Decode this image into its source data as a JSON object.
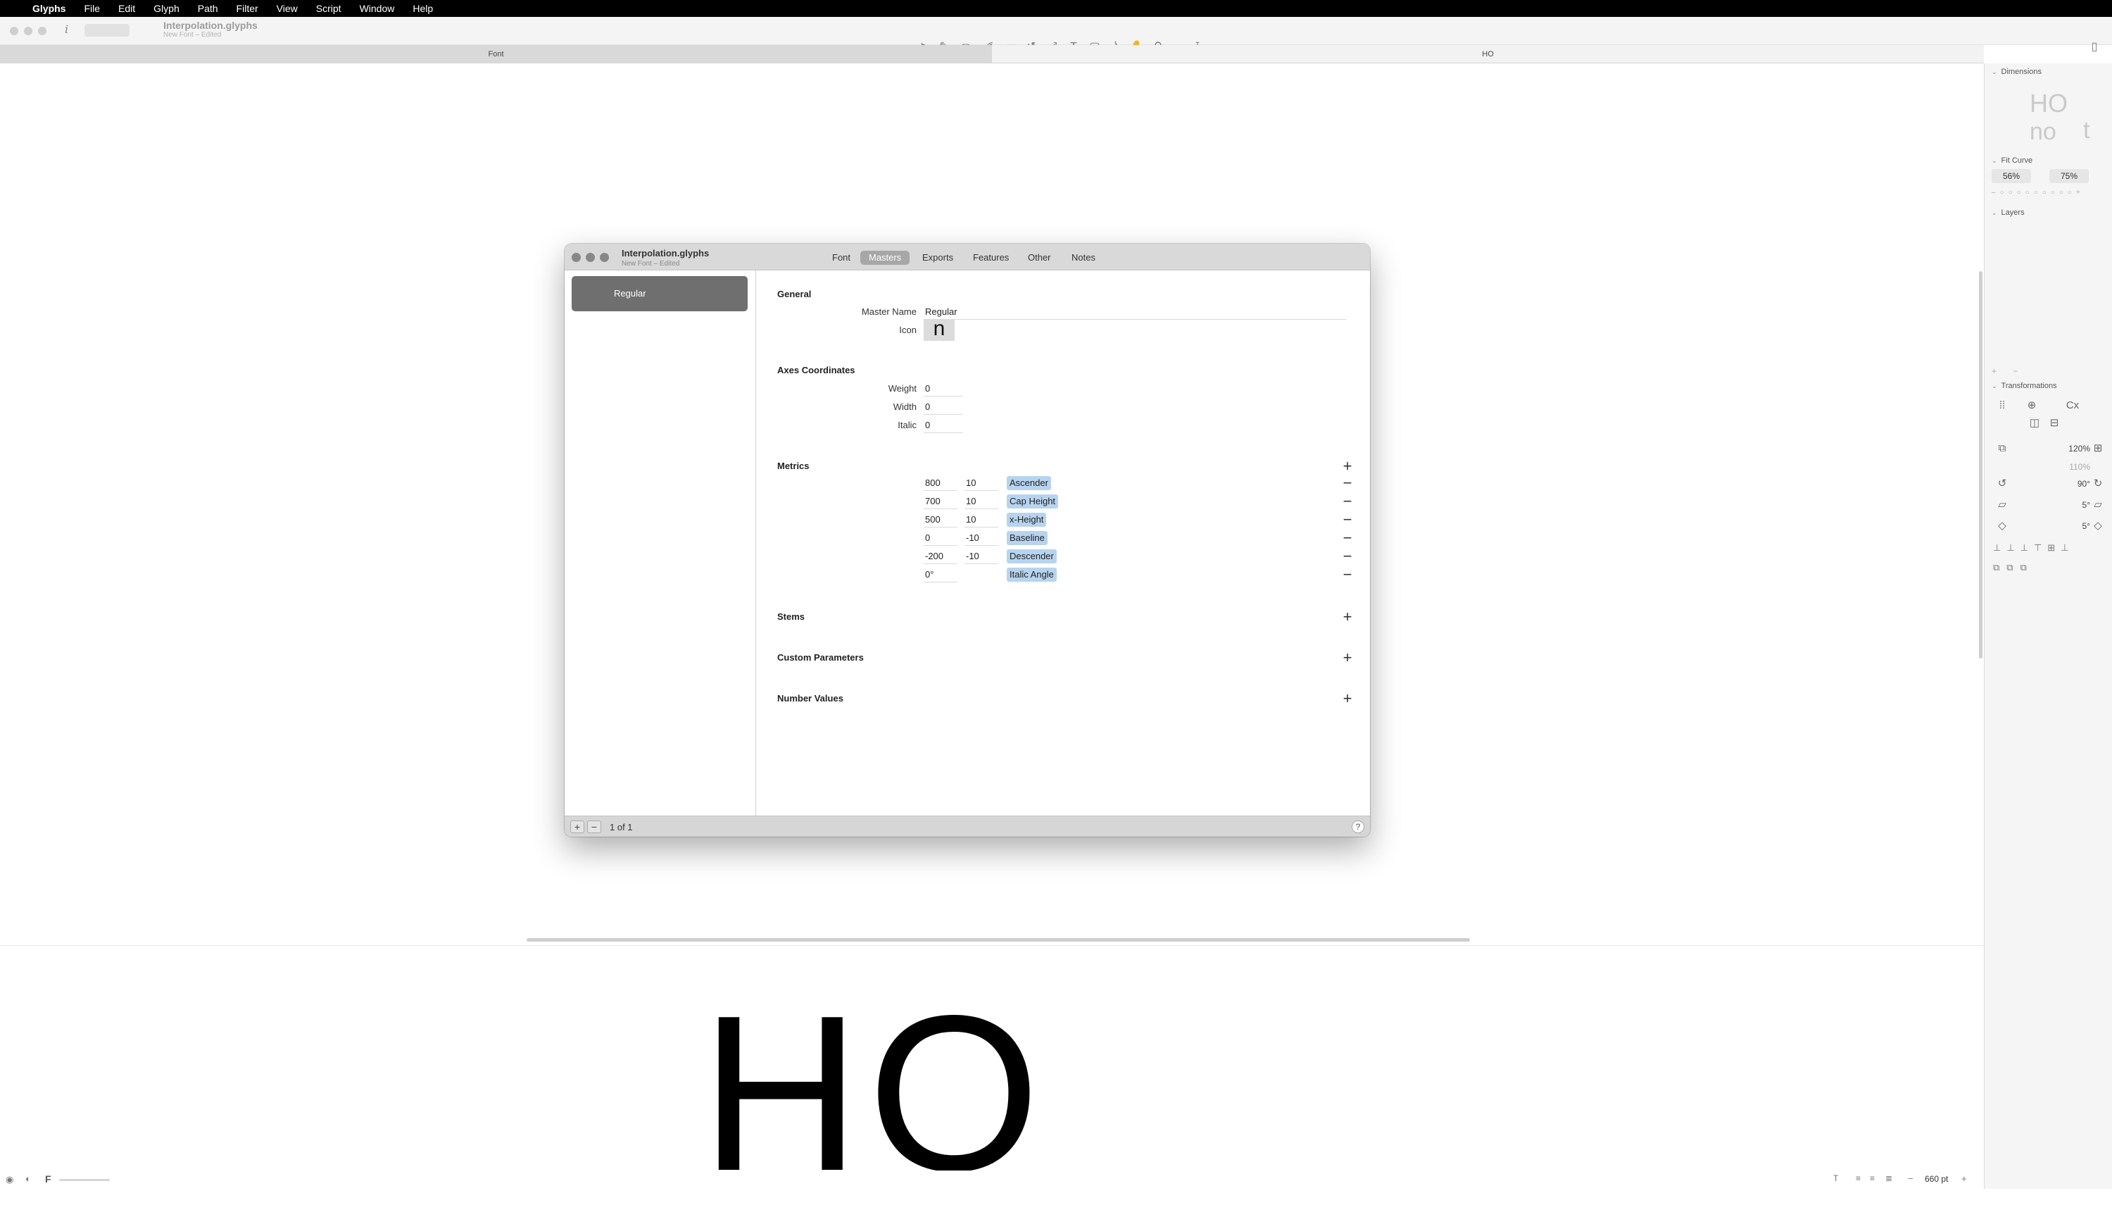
{
  "menubar": {
    "app": "Glyphs",
    "items": [
      "File",
      "Edit",
      "Glyph",
      "Path",
      "Filter",
      "View",
      "Script",
      "Window",
      "Help"
    ]
  },
  "document": {
    "title": "Interpolation.glyphs",
    "subtitle": "New Font – Edited"
  },
  "tabs": {
    "font": "Font",
    "edit": "HO"
  },
  "preview_text": "HO",
  "statusbar": {
    "font_size": "660 pt"
  },
  "inspector": {
    "dimensions": "Dimensions",
    "fit_curve": "Fit Curve",
    "fit_a": "56%",
    "fit_b": "75%",
    "layers": "Layers",
    "transformations": "Transformations",
    "scale_a": "120%",
    "scale_b": "110%",
    "rotate": "90°",
    "slant_a": "5°",
    "slant_b": "5°"
  },
  "font_info": {
    "title": "Interpolation.glyphs",
    "subtitle": "New Font – Edited",
    "tabs": [
      "Font",
      "Masters",
      "Exports",
      "Features",
      "Other",
      "Notes"
    ],
    "active_tab": "Masters",
    "master_list": [
      "Regular"
    ],
    "count": "1 of 1",
    "general": {
      "heading": "General",
      "master_name_label": "Master Name",
      "master_name": "Regular",
      "icon_label": "Icon",
      "icon_glyph": "n"
    },
    "axes": {
      "heading": "Axes Coordinates",
      "rows": [
        {
          "label": "Weight",
          "value": "0"
        },
        {
          "label": "Width",
          "value": "0"
        },
        {
          "label": "Italic",
          "value": "0"
        }
      ]
    },
    "metrics": {
      "heading": "Metrics",
      "rows": [
        {
          "value": "800",
          "overshoot": "10",
          "name": "Ascender"
        },
        {
          "value": "700",
          "overshoot": "10",
          "name": "Cap Height"
        },
        {
          "value": "500",
          "overshoot": "10",
          "name": "x-Height"
        },
        {
          "value": "0",
          "overshoot": "-10",
          "name": "Baseline"
        },
        {
          "value": "-200",
          "overshoot": "-10",
          "name": "Descender"
        },
        {
          "value": "0°",
          "overshoot": "",
          "name": "Italic Angle"
        }
      ]
    },
    "stems": "Stems",
    "custom_parameters": "Custom Parameters",
    "number_values": "Number Values"
  }
}
